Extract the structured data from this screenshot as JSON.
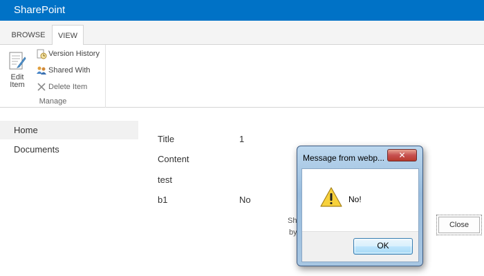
{
  "suitebar": {
    "brand": "SharePoint",
    "color": "#0072c6"
  },
  "ribbon": {
    "tabs": [
      {
        "label": "BROWSE"
      },
      {
        "label": "VIEW"
      }
    ],
    "edit_item": {
      "line1": "Edit",
      "line2": "Item",
      "icon": "edit-document-icon"
    },
    "version_history": {
      "label": "Version History",
      "icon": "version-history-icon"
    },
    "shared_with": {
      "label": "Shared With",
      "icon": "shared-with-icon"
    },
    "delete_item": {
      "label": "Delete Item",
      "icon": "delete-x-icon"
    },
    "group_label": "Manage"
  },
  "nav": {
    "items": [
      {
        "label": "Home"
      },
      {
        "label": "Documents"
      }
    ]
  },
  "item": {
    "title_label": "Title",
    "title_value": "1",
    "content_label": "Content",
    "content_value": "test",
    "b1_label": "b1",
    "b1_value": "No"
  },
  "footer_fragment": {
    "line1": "Sh",
    "line2": "by"
  },
  "close_button": "Close",
  "dialog": {
    "title": "Message from webp...",
    "message": "No!",
    "ok_label": "OK",
    "warning_icon": "warning-icon",
    "close_icon": "close-icon"
  }
}
